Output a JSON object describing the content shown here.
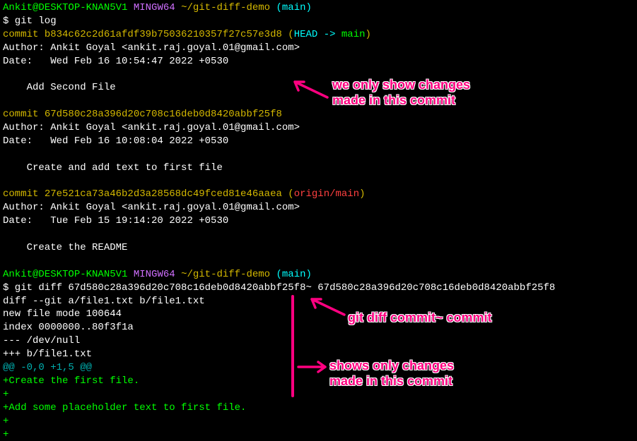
{
  "prompt1": {
    "user": "Ankit@DESKTOP-KNAN5V1",
    "shell": "MINGW64",
    "path": "~/git-diff-demo",
    "branch": "(main)"
  },
  "cmd1": "$ git log",
  "commits": [
    {
      "hash_prefix": "commit ",
      "hash": "b834c62c2d61afdf39b75036210357f27c57e3d8",
      "ref_open": " (",
      "ref1": "HEAD -> ",
      "ref2": "main",
      "ref_close": ")",
      "author": "Author: Ankit Goyal <ankit.raj.goyal.01@gmail.com>",
      "date": "Date:   Wed Feb 16 10:54:47 2022 +0530",
      "msg": "    Add Second File"
    },
    {
      "hash_prefix": "commit ",
      "hash": "67d580c28a396d20c708c16deb0d8420abbf25f8",
      "author": "Author: Ankit Goyal <ankit.raj.goyal.01@gmail.com>",
      "date": "Date:   Wed Feb 16 10:08:04 2022 +0530",
      "msg": "    Create and add text to first file"
    },
    {
      "hash_prefix": "commit ",
      "hash": "27e521ca73a46b2d3a28568dc49fced81e46aaea",
      "ref_open": " (",
      "ref_origin": "origin/main",
      "ref_close": ")",
      "author": "Author: Ankit Goyal <ankit.raj.goyal.01@gmail.com>",
      "date": "Date:   Tue Feb 15 19:14:20 2022 +0530",
      "msg": "    Create the README"
    }
  ],
  "prompt2": {
    "user": "Ankit@DESKTOP-KNAN5V1",
    "shell": "MINGW64",
    "path": "~/git-diff-demo",
    "branch": "(main)"
  },
  "cmd2": "$ git diff 67d580c28a396d20c708c16deb0d8420abbf25f8~ 67d580c28a396d20c708c16deb0d8420abbf25f8",
  "diff": {
    "header": "diff --git a/file1.txt b/file1.txt",
    "newfile": "new file mode 100644",
    "index": "index 0000000..80f3f1a",
    "minus": "--- /dev/null",
    "plus": "+++ b/file1.txt",
    "hunk": "@@ -0,0 +1,5 @@",
    "add1": "+Create the first file.",
    "add2": "+",
    "add3": "+Add some placeholder text to first file.",
    "add4": "+",
    "add5": "+"
  },
  "annotations": {
    "a1_line1": "we only show changes",
    "a1_line2": "made in this commit",
    "a2": "git diff commit~ commit",
    "a3_line1": "shows only changes",
    "a3_line2": "made in this commit"
  }
}
